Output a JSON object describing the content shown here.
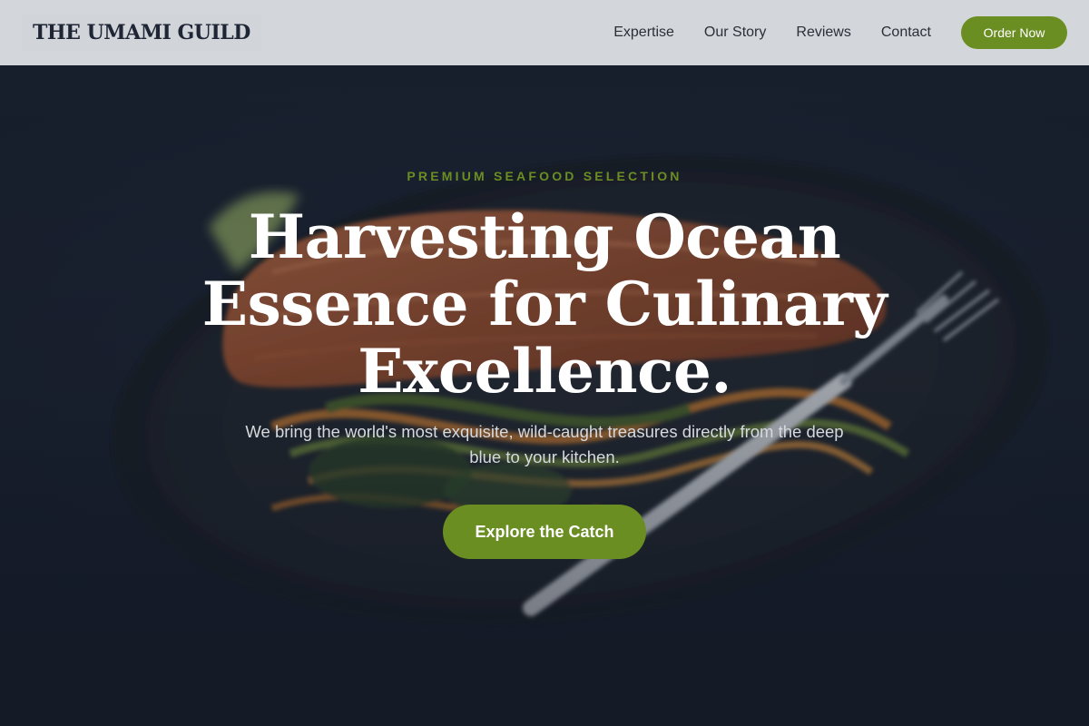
{
  "brand": {
    "name": "THE UMAMI GUILD"
  },
  "nav": {
    "links": [
      "Expertise",
      "Our Story",
      "Reviews",
      "Contact"
    ],
    "cta_label": "Order Now"
  },
  "hero": {
    "eyebrow": "PREMIUM SEAFOOD SELECTION",
    "headline": "Harvesting Ocean Essence for Culinary Excellence.",
    "subtext": "We bring the world's most exquisite, wild-caught treasures directly from the deep blue to your kitchen.",
    "cta_label": "Explore the Catch",
    "image_subject": "seared salmon fillet with vegetable noodles on a dark plate with a fork"
  },
  "colors": {
    "accent": "#6b8e23",
    "navbar_bg": "#e2e5e8",
    "hero_dark": "#1b2230",
    "text_light": "#ffffff"
  }
}
